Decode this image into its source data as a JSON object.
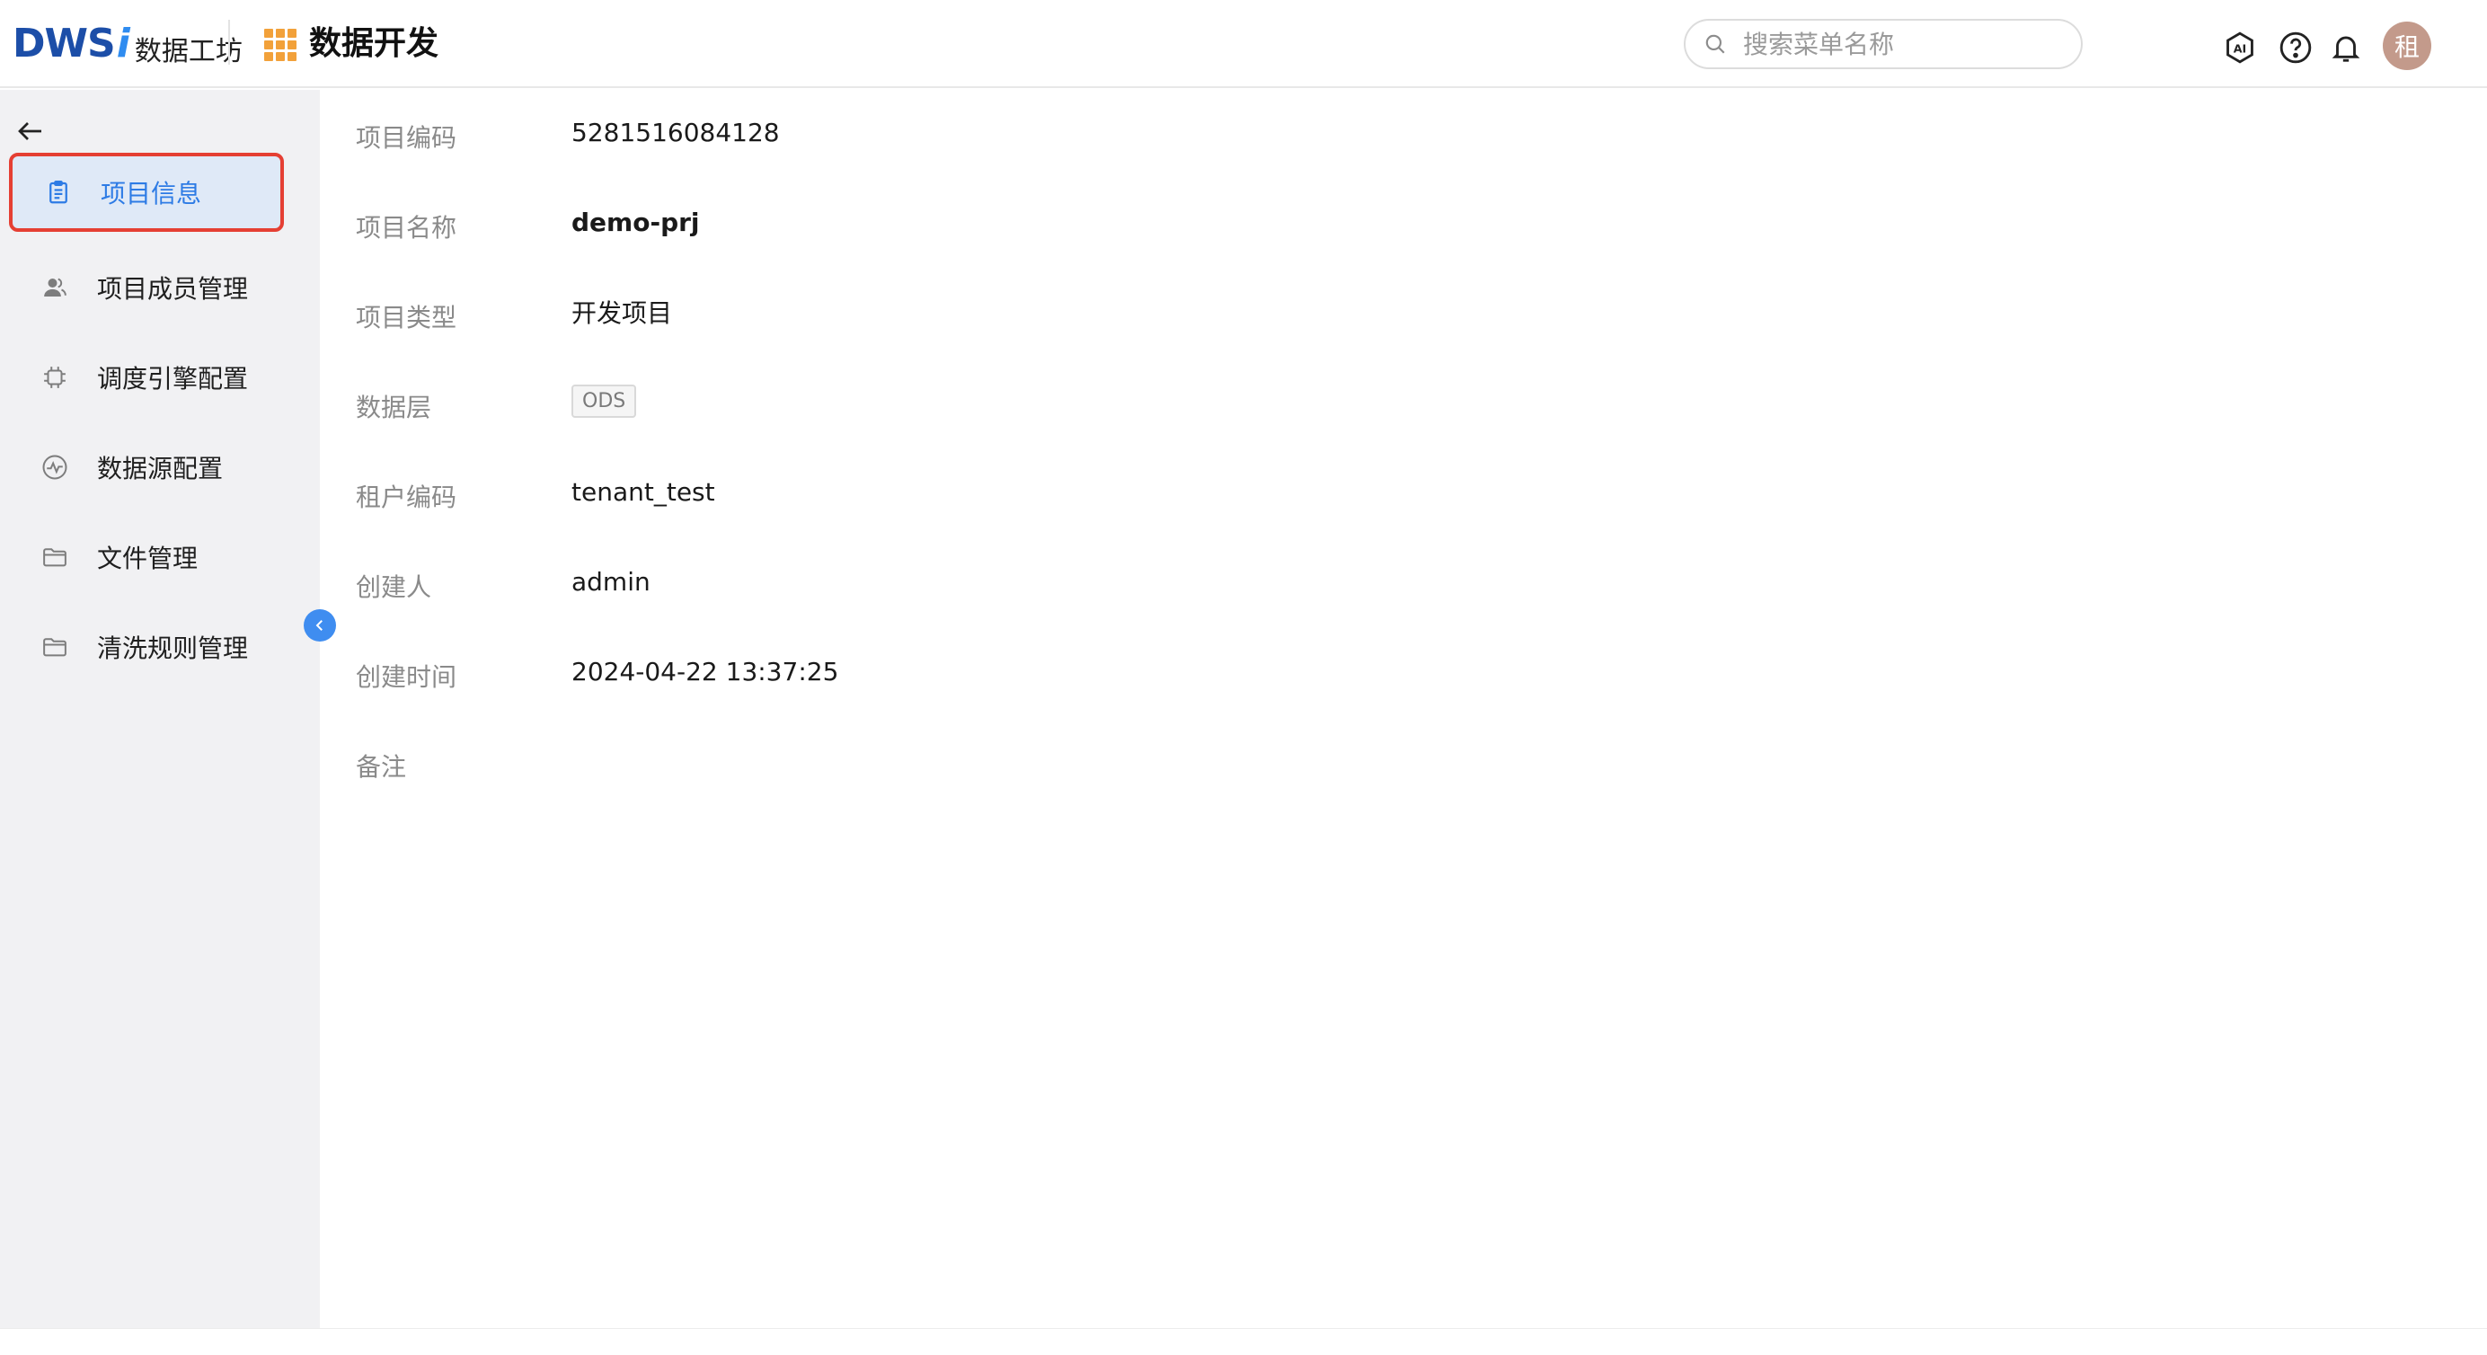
{
  "header": {
    "logo_text": "DWS",
    "logo_i": "i",
    "logo_name": "数据工坊",
    "module_title": "数据开发",
    "search_placeholder": "搜索菜单名称",
    "avatar_text": "租"
  },
  "sidebar": {
    "items": [
      {
        "label": "项目信息",
        "icon": "clipboard-icon",
        "active": true
      },
      {
        "label": "项目成员管理",
        "icon": "user-icon"
      },
      {
        "label": "调度引擎配置",
        "icon": "chip-icon"
      },
      {
        "label": "数据源配置",
        "icon": "pulse-icon"
      },
      {
        "label": "文件管理",
        "icon": "folder-icon"
      },
      {
        "label": "清洗规则管理",
        "icon": "folder-icon"
      }
    ]
  },
  "details": {
    "code_label": "项目编码",
    "code_value": "5281516084128",
    "name_label": "项目名称",
    "name_value": "demo-prj",
    "type_label": "项目类型",
    "type_value": "开发项目",
    "layer_label": "数据层",
    "layer_value": "ODS",
    "tenant_label": "租户编码",
    "tenant_value": "tenant_test",
    "creator_label": "创建人",
    "creator_value": "admin",
    "created_label": "创建时间",
    "created_value": "2024-04-22 13:37:25",
    "note_label": "备注",
    "note_value": ""
  },
  "colors": {
    "accent": "#2d7be5",
    "highlight_border": "#e53f33",
    "grid_icon": "#f2a13a"
  }
}
